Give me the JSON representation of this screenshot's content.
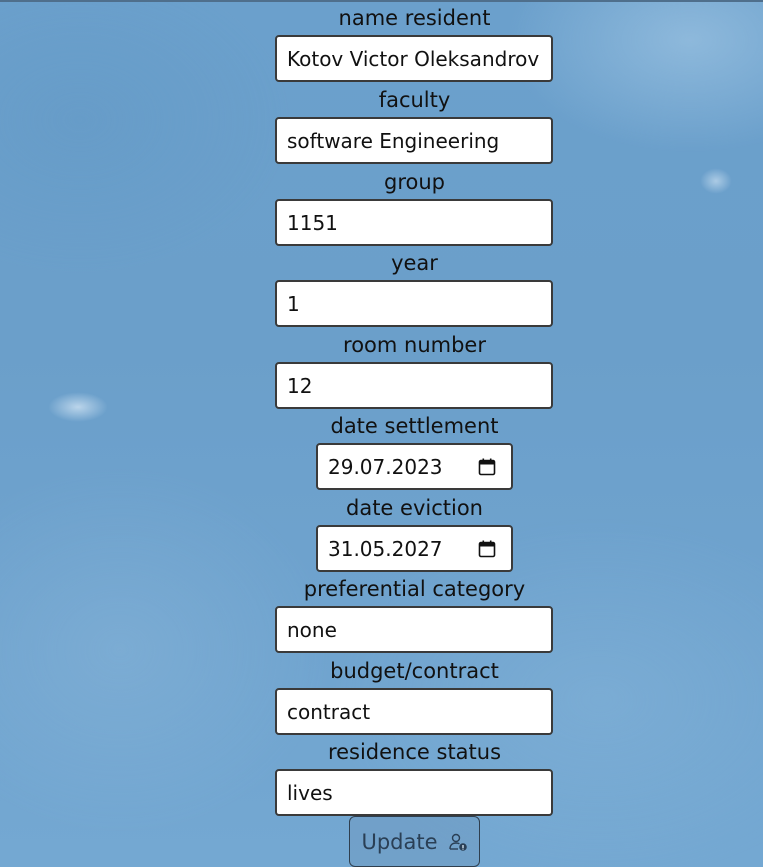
{
  "form": {
    "fields": [
      {
        "label": "name resident",
        "value": "Kotov Victor Oleksandrovich"
      },
      {
        "label": "faculty",
        "value": "software Engineering"
      },
      {
        "label": "group",
        "value": "1151"
      },
      {
        "label": "year",
        "value": "1"
      },
      {
        "label": "room number",
        "value": "12"
      },
      {
        "label": "date settlement",
        "value": "29.07.2023"
      },
      {
        "label": "date eviction",
        "value": "31.05.2027"
      },
      {
        "label": "preferential category",
        "value": "none"
      },
      {
        "label": "budget/contract",
        "value": "contract"
      },
      {
        "label": "residence status",
        "value": "lives"
      }
    ],
    "update_label": "Update",
    "update_icon": "user-lock-icon",
    "date_icon": "calendar-icon"
  },
  "colors": {
    "background": "#6ba0cc",
    "input_border": "#3a3a3a",
    "button_text": "#2a3f55"
  }
}
